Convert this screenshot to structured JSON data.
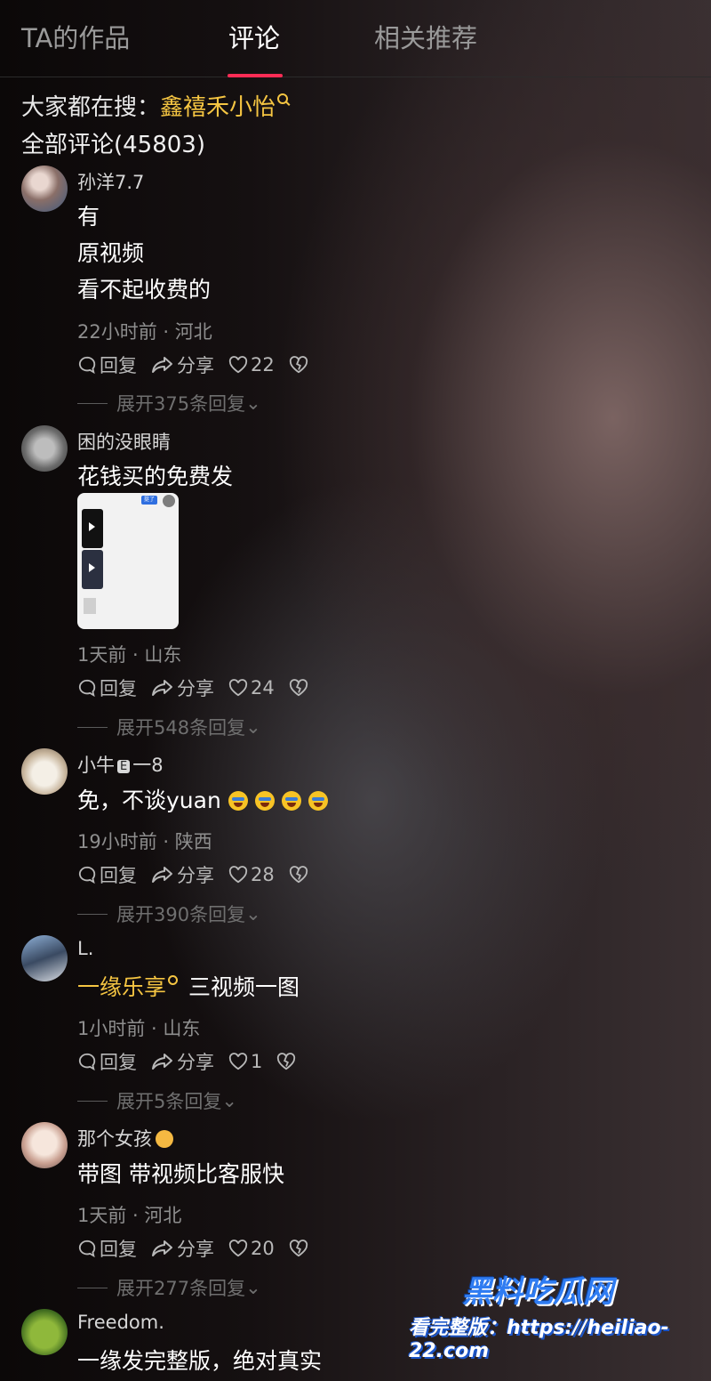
{
  "tabs": [
    {
      "label": "TA的作品",
      "active": false
    },
    {
      "label": "评论",
      "active": true
    },
    {
      "label": "相关推荐",
      "active": false
    }
  ],
  "search": {
    "prefix": "大家都在搜：",
    "keyword": "鑫禧禾小怡"
  },
  "comment_count": "全部评论(45803)",
  "actions": {
    "reply": "回复",
    "share": "分享"
  },
  "colors": {
    "accent": "#fe2c55",
    "keyword": "#f5c542"
  },
  "comments": [
    {
      "user": "孙洋7.7",
      "lines": [
        "有",
        "原视频",
        "看不起收费的"
      ],
      "meta": "22小时前 · 河北",
      "likes": "22",
      "expand": "展开375条回复"
    },
    {
      "user": "困的没眼睛",
      "lines": [
        "花钱买的免费发"
      ],
      "image_badge": "挺了",
      "meta": "1天前 · 山东",
      "likes": "24",
      "expand": "展开548条回复"
    },
    {
      "user": "小牛",
      "user_badge": "E",
      "user_suffix": "一8",
      "text": "免，不谈yuan",
      "emojis": [
        "laugh-cry-emoji",
        "laugh-cry-emoji",
        "laugh-cry-emoji",
        "laugh-cry-emoji"
      ],
      "meta": "19小时前 · 陕西",
      "likes": "28",
      "expand": "展开390条回复"
    },
    {
      "user": "L.",
      "link": "一缘乐享",
      "text": "三视频一图",
      "meta": "1小时前 · 山东",
      "likes": "1",
      "expand": "展开5条回复"
    },
    {
      "user": "那个女孩",
      "user_emoji": "girl-emoji",
      "text": "带图 带视频比客服快",
      "meta": "1天前 · 河北",
      "likes": "20",
      "expand": "展开277条回复"
    },
    {
      "user": "Freedom.",
      "text": "一缘发完整版，绝对真实"
    }
  ],
  "watermark": {
    "title": "黑料吃瓜网",
    "url": "看完整版：https://heiliao-22.com"
  }
}
